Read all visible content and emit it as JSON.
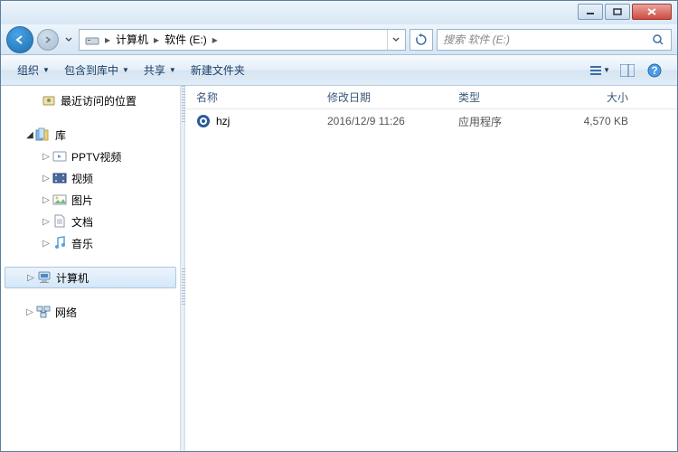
{
  "breadcrumb": {
    "segments": [
      "计算机",
      "软件 (E:)"
    ]
  },
  "search": {
    "placeholder": "搜索 软件 (E:)"
  },
  "toolbar": {
    "organize": "组织",
    "include": "包含到库中",
    "share": "共享",
    "newfolder": "新建文件夹"
  },
  "columns": {
    "name": "名称",
    "date": "修改日期",
    "type": "类型",
    "size": "大小"
  },
  "files": [
    {
      "name": "hzj",
      "date": "2016/12/9 11:26",
      "type": "应用程序",
      "size": "4,570 KB"
    }
  ],
  "sidebar": {
    "recent": "最近访问的位置",
    "libraries": "库",
    "pptv": "PPTV视频",
    "video": "视频",
    "pictures": "图片",
    "documents": "文档",
    "music": "音乐",
    "computer": "计算机",
    "network": "网络"
  }
}
